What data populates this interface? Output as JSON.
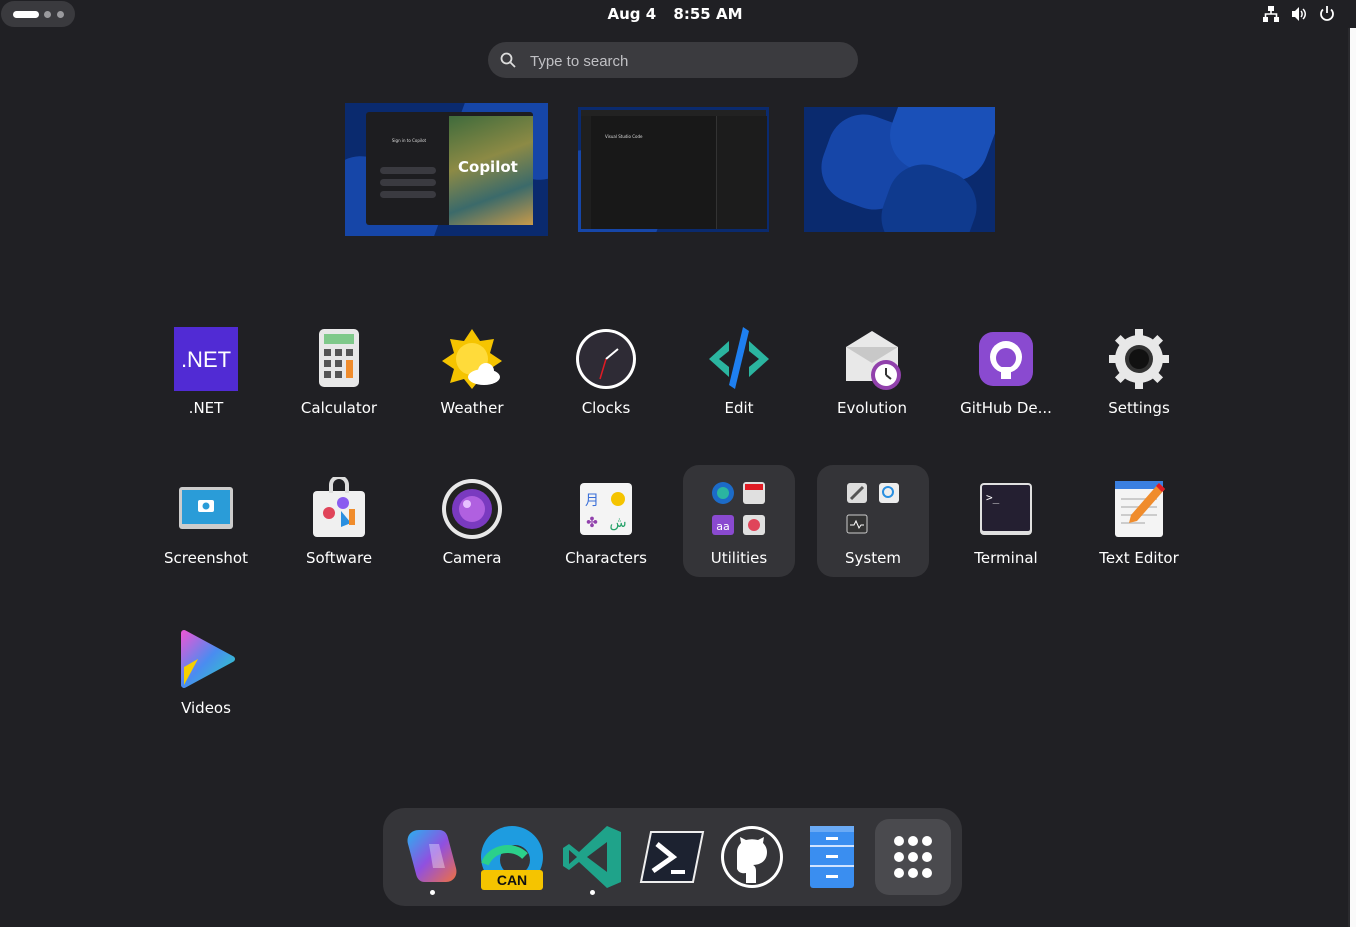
{
  "topbar": {
    "date": "Aug 4",
    "time": "8:55 AM",
    "tray_icons": [
      "network-icon",
      "volume-icon",
      "power-icon"
    ]
  },
  "search": {
    "placeholder": "Type to search"
  },
  "workspaces": [
    {
      "name": "workspace-1",
      "window_text": "Copilot",
      "dialog_title": "Sign in to Copilot"
    },
    {
      "name": "workspace-2",
      "window_text": "Visual Studio Code"
    },
    {
      "name": "workspace-3"
    }
  ],
  "apps": [
    {
      "label": ".NET",
      "icon": "dotnet-icon"
    },
    {
      "label": "Calculator",
      "icon": "calculator-icon"
    },
    {
      "label": "Weather",
      "icon": "weather-icon"
    },
    {
      "label": "Clocks",
      "icon": "clock-icon"
    },
    {
      "label": "Edit",
      "icon": "edit-icon"
    },
    {
      "label": "Evolution",
      "icon": "evolution-icon"
    },
    {
      "label": "GitHub De...",
      "icon": "github-desktop-icon"
    },
    {
      "label": "Settings",
      "icon": "settings-icon"
    },
    {
      "label": "Screenshot",
      "icon": "screenshot-icon"
    },
    {
      "label": "Software",
      "icon": "software-icon"
    },
    {
      "label": "Camera",
      "icon": "camera-icon"
    },
    {
      "label": "Characters",
      "icon": "characters-icon"
    },
    {
      "label": "Utilities",
      "icon": "utilities-folder-icon"
    },
    {
      "label": "System",
      "icon": "system-folder-icon"
    },
    {
      "label": "Terminal",
      "icon": "terminal-icon"
    },
    {
      "label": "Text Editor",
      "icon": "text-editor-icon"
    },
    {
      "label": "Videos",
      "icon": "videos-icon"
    }
  ],
  "dock": {
    "items": [
      "copilot-icon",
      "edge-canary-icon",
      "vscode-icon",
      "powershell-icon",
      "github-icon",
      "files-icon",
      "app-grid-icon"
    ],
    "edge_badge": "CAN"
  }
}
